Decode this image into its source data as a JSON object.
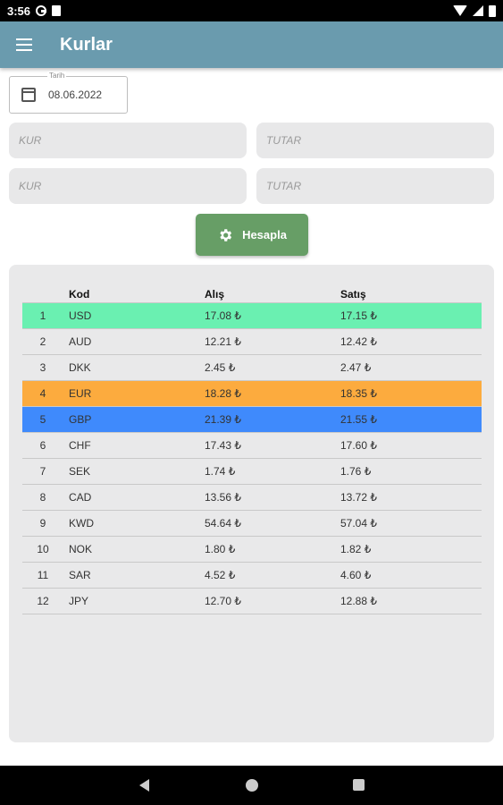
{
  "status_bar": {
    "time": "3:56"
  },
  "app_bar": {
    "title": "Kurlar"
  },
  "date": {
    "label": "Tarih",
    "value": "08.06.2022"
  },
  "inputs": [
    {
      "placeholder": "KUR"
    },
    {
      "placeholder": "TUTAR"
    },
    {
      "placeholder": "KUR"
    },
    {
      "placeholder": "TUTAR"
    }
  ],
  "calc_button": {
    "label": "Hesapla"
  },
  "table": {
    "headers": {
      "code": "Kod",
      "buy": "Alış",
      "sell": "Satış"
    },
    "rows": [
      {
        "idx": "1",
        "code": "USD",
        "buy": "17.08 ₺",
        "sell": "17.15 ₺",
        "highlight": "#6af0b1"
      },
      {
        "idx": "2",
        "code": "AUD",
        "buy": "12.21 ₺",
        "sell": "12.42 ₺"
      },
      {
        "idx": "3",
        "code": "DKK",
        "buy": "2.45 ₺",
        "sell": "2.47 ₺"
      },
      {
        "idx": "4",
        "code": "EUR",
        "buy": "18.28 ₺",
        "sell": "18.35 ₺",
        "highlight": "#fcab3e"
      },
      {
        "idx": "5",
        "code": "GBP",
        "buy": "21.39 ₺",
        "sell": "21.55 ₺",
        "highlight": "#3f8afc"
      },
      {
        "idx": "6",
        "code": "CHF",
        "buy": "17.43 ₺",
        "sell": "17.60 ₺"
      },
      {
        "idx": "7",
        "code": "SEK",
        "buy": "1.74 ₺",
        "sell": "1.76 ₺"
      },
      {
        "idx": "8",
        "code": "CAD",
        "buy": "13.56 ₺",
        "sell": "13.72 ₺"
      },
      {
        "idx": "9",
        "code": "KWD",
        "buy": "54.64 ₺",
        "sell": "57.04 ₺"
      },
      {
        "idx": "10",
        "code": "NOK",
        "buy": "1.80 ₺",
        "sell": "1.82 ₺"
      },
      {
        "idx": "11",
        "code": "SAR",
        "buy": "4.52 ₺",
        "sell": "4.60 ₺"
      },
      {
        "idx": "12",
        "code": "JPY",
        "buy": "12.70 ₺",
        "sell": "12.88 ₺"
      }
    ]
  },
  "colors": {
    "app_bar": "#6a9bae",
    "button": "#679e66",
    "card": "#e9e9ea"
  }
}
